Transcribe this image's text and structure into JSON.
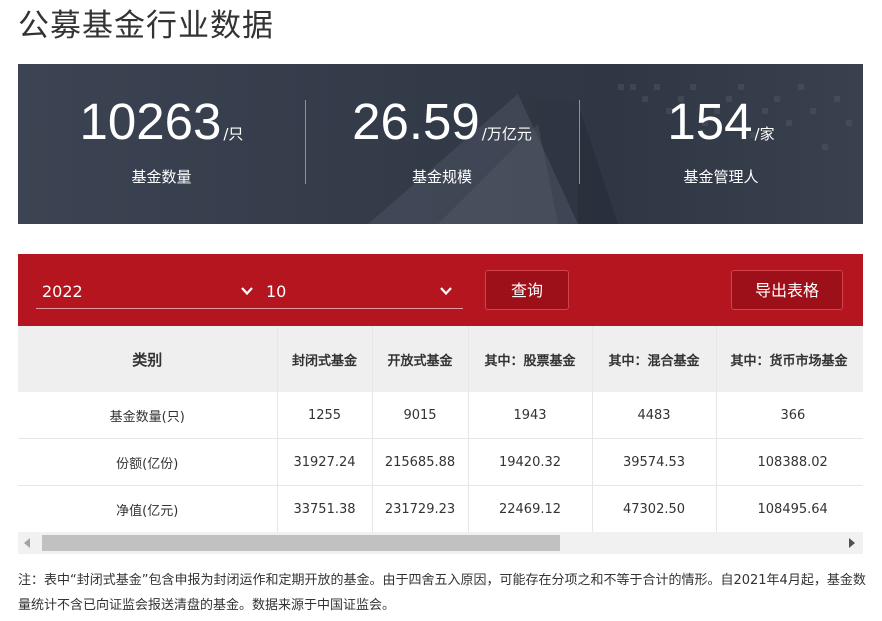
{
  "page_title": "公募基金行业数据",
  "stats": [
    {
      "value": "10263",
      "unit": "/只",
      "label": "基金数量"
    },
    {
      "value": "26.59",
      "unit": "/万亿元",
      "label": "基金规模"
    },
    {
      "value": "154",
      "unit": "/家",
      "label": "基金管理人"
    }
  ],
  "filters": {
    "year": "2022",
    "month": "10",
    "query_label": "查询",
    "export_label": "导出表格"
  },
  "table": {
    "headers": [
      "类别",
      "封闭式基金",
      "开放式基金",
      "其中：股票基金",
      "其中：混合基金",
      "其中：货币市场基金"
    ],
    "rows": [
      [
        "基金数量(只)",
        "1255",
        "9015",
        "1943",
        "4483",
        "366"
      ],
      [
        "份额(亿份)",
        "31927.24",
        "215685.88",
        "19420.32",
        "39574.53",
        "108388.02"
      ],
      [
        "净值(亿元)",
        "33751.38",
        "231729.23",
        "22469.12",
        "47302.50",
        "108495.64"
      ]
    ]
  },
  "note": "注：表中“封闭式基金”包含申报为封闭运作和定期开放的基金。由于四舍五入原因，可能存在分项之和不等于合计的情形。自2021年4月起，基金数量统计不含已向证监会报送清盘的基金。数据来源于中国证监会。",
  "colors": {
    "banner_bg": "#333b49",
    "filter_bar_bg": "#b4151f",
    "button_bg": "#9d1019",
    "header_bg": "#efefef"
  },
  "icons": [
    "chevron-down-icon",
    "scroll-left-arrow-icon",
    "scroll-right-arrow-icon"
  ]
}
